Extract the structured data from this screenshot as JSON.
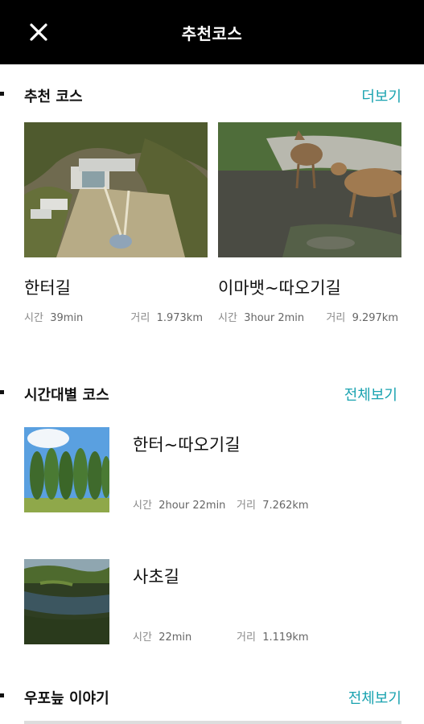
{
  "appbar": {
    "title": "추천코스",
    "close_icon": "close-icon"
  },
  "recommended": {
    "title": "추천 코스",
    "more_label": "더보기",
    "cards": [
      {
        "name": "한터길",
        "time_label": "시간",
        "time": "39min",
        "dist_label": "거리",
        "dist": "1.973km",
        "image": "aerial-building-photo"
      },
      {
        "name": "이마뱃~따오기길",
        "time_label": "시간",
        "time": "3hour 2min",
        "dist_label": "거리",
        "dist": "9.297km",
        "image": "deer-photo"
      }
    ]
  },
  "by_time": {
    "title": "시간대별 코스",
    "more_label": "전체보기",
    "items": [
      {
        "name": "한터~따오기길",
        "time_label": "시간",
        "time": "2hour 22min",
        "dist_label": "거리",
        "dist": "7.262km",
        "image": "poplar-trees-photo"
      },
      {
        "name": "사초길",
        "time_label": "시간",
        "time": "22min",
        "dist_label": "거리",
        "dist": "1.119km",
        "image": "wetland-photo"
      }
    ]
  },
  "stories": {
    "title": "우포늪 이야기",
    "more_label": "전체보기"
  },
  "colors": {
    "accent": "#1aa3b0",
    "appbar": "#000000",
    "text": "#111111",
    "meta": "#888888"
  }
}
